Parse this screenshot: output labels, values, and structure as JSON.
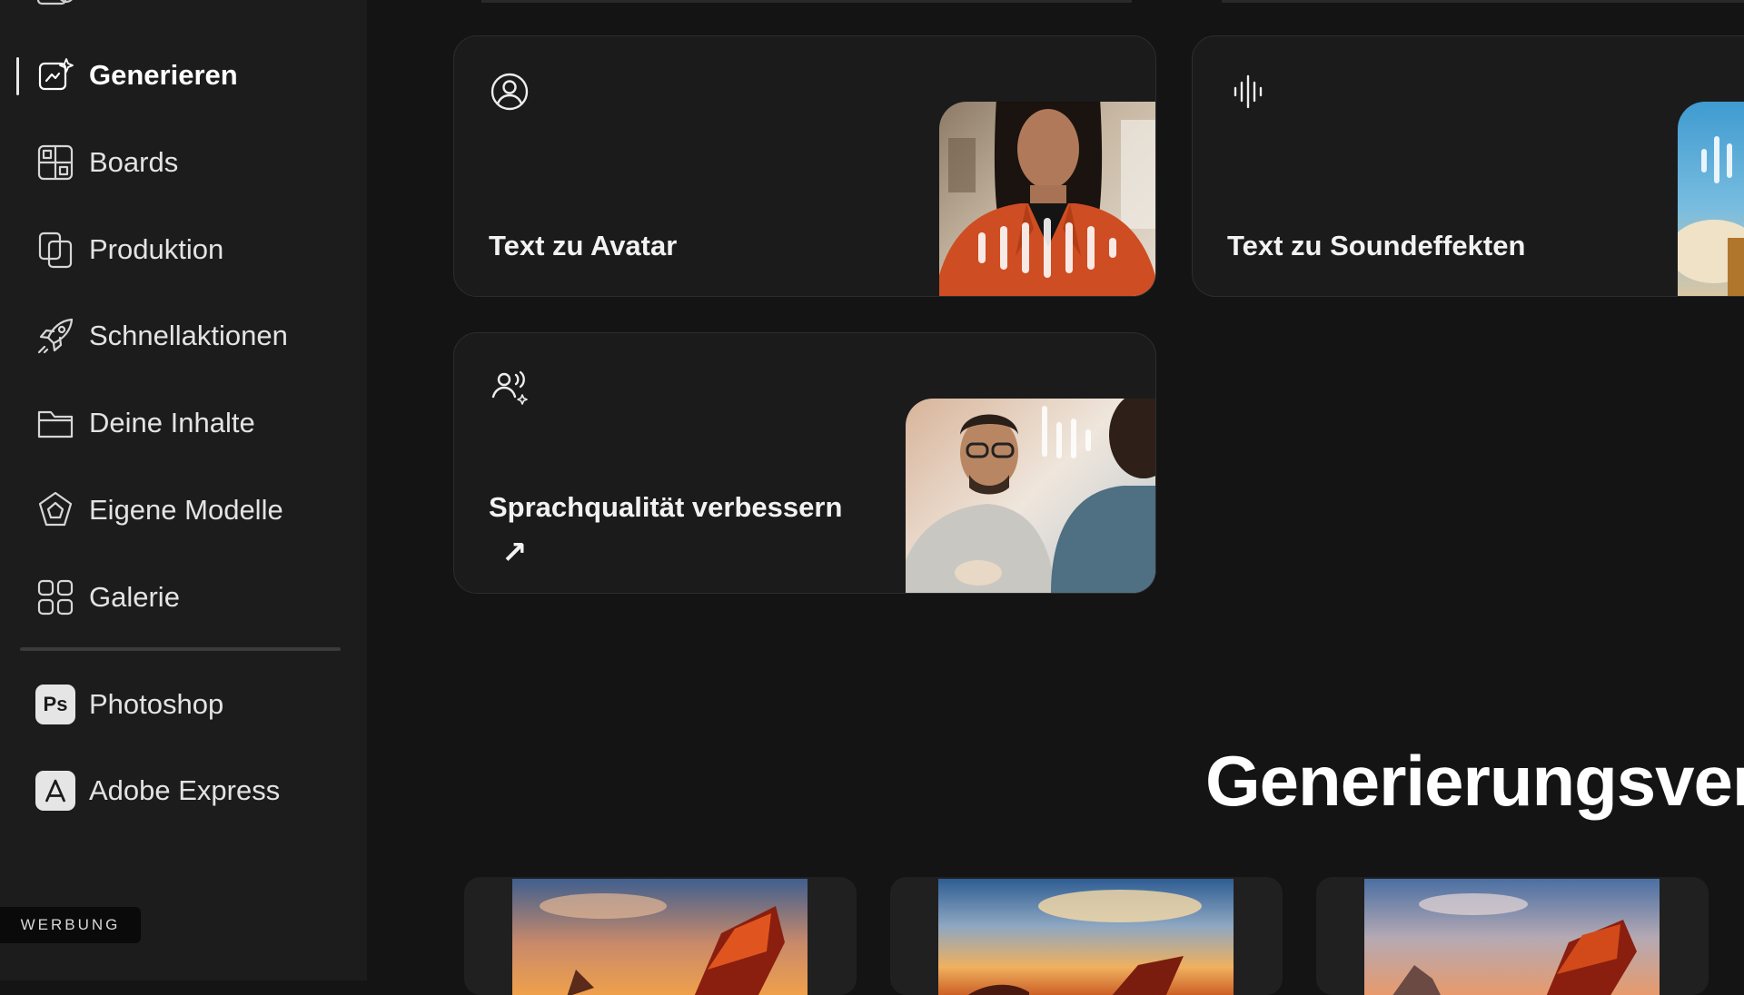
{
  "sidebar": {
    "items": [
      {
        "label": "Generieren",
        "icon": "generate-sparkle-icon",
        "active": true
      },
      {
        "label": "Boards",
        "icon": "boards-icon"
      },
      {
        "label": "Produktion",
        "icon": "production-copy-icon"
      },
      {
        "label": "Schnellaktionen",
        "icon": "rocket-icon"
      },
      {
        "label": "Deine Inhalte",
        "icon": "folder-icon"
      },
      {
        "label": "Eigene Modelle",
        "icon": "custom-models-icon"
      },
      {
        "label": "Galerie",
        "icon": "gallery-icon"
      }
    ],
    "apps": [
      {
        "label": "Photoshop",
        "icon": "photoshop-icon",
        "badge": "Ps"
      },
      {
        "label": "Adobe Express",
        "icon": "adobe-express-icon"
      }
    ]
  },
  "ad_label": "WERBUNG",
  "cards": [
    {
      "title": "Text zu Avatar",
      "icon": "avatar-user-circle-icon"
    },
    {
      "title": "Text zu Soundeffekten",
      "icon": "audio-waveform-icon"
    },
    {
      "title": "Sprachqualität verbessern",
      "icon": "enhance-speech-icon",
      "external_arrow": "↗"
    }
  ],
  "section_title": "Generierungsver",
  "thumbnails": [
    {
      "name": "dragon-sunset-1"
    },
    {
      "name": "dragon-sunset-2"
    },
    {
      "name": "dragon-sunset-3"
    }
  ],
  "colors": {
    "background": "#141414",
    "sidebar": "#1c1c1c",
    "card": "#1b1b1b",
    "card_border": "#2d2d2d",
    "text": "#ffffff"
  }
}
